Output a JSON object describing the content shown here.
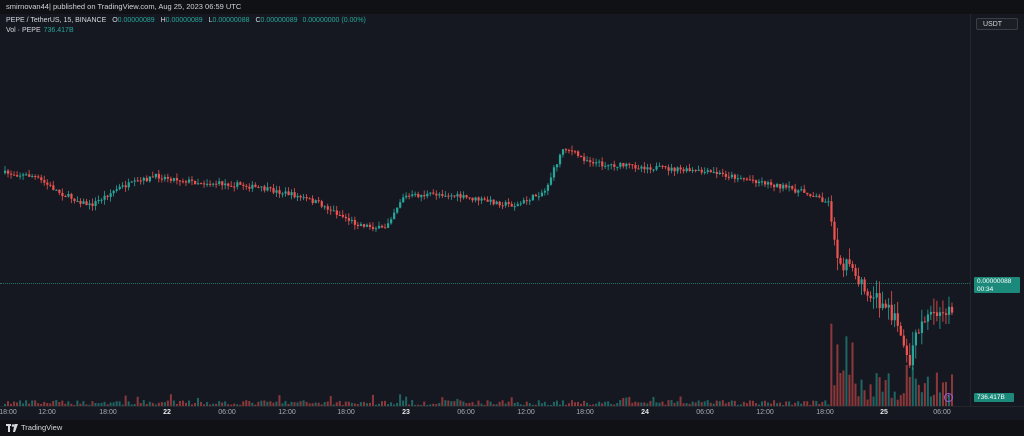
{
  "header": {
    "published": "smirnovan44| published on TradingView.com, Aug 25, 2023 06:59 UTC"
  },
  "legend": {
    "symbol": "PEPE / TetherUS, 15, BINANCE",
    "open_label": "O",
    "open_value": "0.00000089",
    "high_label": "H",
    "high_value": "0.00000089",
    "low_label": "L",
    "low_value": "0.00000088",
    "close_label": "C",
    "close_value": "0.00000089",
    "change": "0.00000000 (0.00%)",
    "volume_label": "Vol · PEPE",
    "volume_value": "736.417B"
  },
  "right_axis": {
    "currency": "USDT",
    "last_price": "0.00000088",
    "countdown": "00:34",
    "volume_tag": "736.417B"
  },
  "time_axis": {
    "labels": [
      {
        "text": "18:00",
        "day": false
      },
      {
        "text": "12:00",
        "day": false
      },
      {
        "text": "18:00",
        "day": false
      },
      {
        "text": "22",
        "day": true
      },
      {
        "text": "06:00",
        "day": false
      },
      {
        "text": "12:00",
        "day": false
      },
      {
        "text": "18:00",
        "day": false
      },
      {
        "text": "23",
        "day": true
      },
      {
        "text": "06:00",
        "day": false
      },
      {
        "text": "12:00",
        "day": false
      },
      {
        "text": "18:00",
        "day": false
      },
      {
        "text": "24",
        "day": true
      },
      {
        "text": "06:00",
        "day": false
      },
      {
        "text": "12:00",
        "day": false
      },
      {
        "text": "18:00",
        "day": false
      },
      {
        "text": "25",
        "day": true
      },
      {
        "text": "06:00",
        "day": false
      }
    ]
  },
  "footer": {
    "brand": "TradingView"
  },
  "colors": {
    "up": "#26a69a",
    "down": "#ef5350",
    "background": "#151820"
  },
  "chart_data": {
    "type": "candlestick",
    "interval": "15",
    "anchors": [
      [
        0,
        0.63
      ],
      [
        0.03,
        0.62
      ],
      [
        0.06,
        0.56
      ],
      [
        0.09,
        0.52
      ],
      [
        0.12,
        0.58
      ],
      [
        0.16,
        0.62
      ],
      [
        0.2,
        0.6
      ],
      [
        0.25,
        0.59
      ],
      [
        0.3,
        0.56
      ],
      [
        0.33,
        0.53
      ],
      [
        0.37,
        0.46
      ],
      [
        0.4,
        0.44
      ],
      [
        0.42,
        0.55
      ],
      [
        0.46,
        0.56
      ],
      [
        0.5,
        0.54
      ],
      [
        0.54,
        0.52
      ],
      [
        0.57,
        0.57
      ],
      [
        0.59,
        0.72
      ],
      [
        0.61,
        0.68
      ],
      [
        0.63,
        0.66
      ],
      [
        0.68,
        0.65
      ],
      [
        0.75,
        0.63
      ],
      [
        0.8,
        0.6
      ],
      [
        0.85,
        0.56
      ],
      [
        0.87,
        0.53
      ],
      [
        0.88,
        0.35
      ],
      [
        0.9,
        0.26
      ],
      [
        0.92,
        0.21
      ],
      [
        0.94,
        0.14
      ],
      [
        0.955,
        0.0
      ],
      [
        0.965,
        0.1
      ],
      [
        0.975,
        0.17
      ],
      [
        0.985,
        0.15
      ],
      [
        1.0,
        0.16
      ]
    ]
  }
}
